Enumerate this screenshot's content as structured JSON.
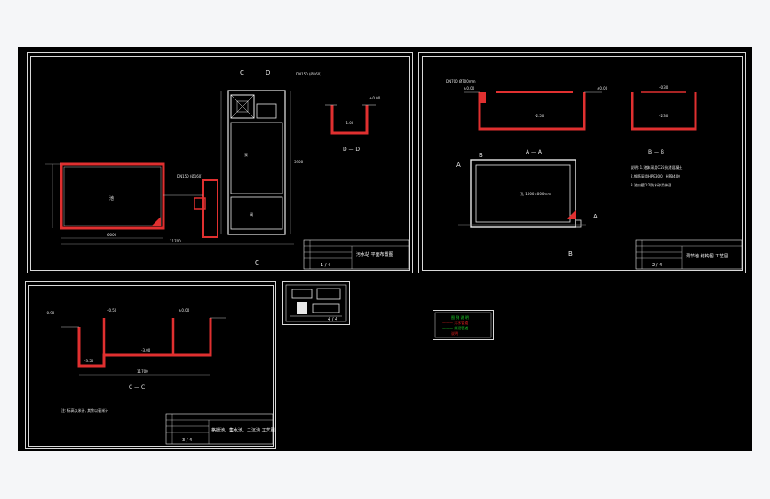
{
  "drawing": {
    "sheet1": {
      "section_marks": [
        "C",
        "D",
        "C"
      ],
      "section_title": "D — D",
      "levels": [
        "-0.90",
        "-1.00",
        "±0.00",
        "0.00",
        "-3.00"
      ],
      "room_labels": [
        "池",
        "泵",
        "池",
        "阀"
      ],
      "dims": [
        "6000",
        "11700",
        "3900",
        "4000"
      ],
      "pipe_note": "DN150 (Ø160)",
      "title_block": "污水站 平面布置图",
      "title_block_no": "1 / 4"
    },
    "sheet2": {
      "section_marks": [
        "A",
        "B",
        "A",
        "B"
      ],
      "section_titles": [
        "A — A",
        "B — B"
      ],
      "levels": [
        "±0.00",
        "-2.50",
        "-0.30",
        "-2.30"
      ],
      "pipe_note": "DN700 Ø700mm",
      "opening_note": "孔 1000×800mm",
      "spec_notes": [
        "说明: 1.池体采用C25抗渗混凝土",
        "2.钢筋采用HPB300、HRB400",
        "3.池内壁1:2防水砂浆抹面"
      ],
      "title_block": "调节池 结构图 工艺图",
      "title_block_no": "2 / 4"
    },
    "sheet3": {
      "section_title": "C — C",
      "levels": [
        "-0.90",
        "-0.50",
        "±0.00",
        "-3.50",
        "-3.00"
      ],
      "dims": [
        "11700",
        "2500",
        "4000"
      ],
      "note": "注: 标高以米计, 其余以毫米计",
      "title_block": "格栅池、集水池、二沉池 工艺图",
      "title_block_no": "3 / 4"
    },
    "sheet4": {
      "title_block_no": "4 / 4"
    },
    "legend": {
      "lines": [
        "图 例 说 明",
        "——— 污水管道",
        "——— 排泥管道",
        "说明"
      ]
    }
  },
  "colors": {
    "background": "#000000",
    "border": "#d8d8d8",
    "wall": "#e03030",
    "dim": "#8a8a8a",
    "legend_green": "#1fd32a",
    "legend_red": "#e02020"
  }
}
